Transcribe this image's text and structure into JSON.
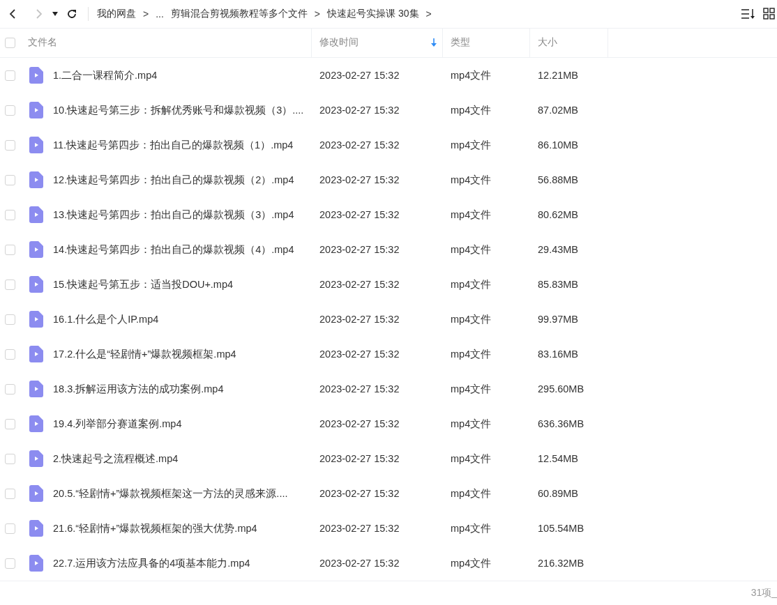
{
  "toolbar": {
    "back_disabled": false,
    "forward_disabled": true,
    "breadcrumb": [
      {
        "label": "我的网盘",
        "kind": "crumb"
      },
      {
        "label": ">",
        "kind": "sep"
      },
      {
        "label": "...",
        "kind": "crumb"
      },
      {
        "label": "剪辑混合剪视频教程等多个文件",
        "kind": "crumb"
      },
      {
        "label": ">",
        "kind": "sep"
      },
      {
        "label": "快速起号实操课 30集",
        "kind": "crumb"
      },
      {
        "label": ">",
        "kind": "sep"
      }
    ]
  },
  "table": {
    "all_checked": false,
    "columns": [
      {
        "label": "文件名",
        "sorted": false
      },
      {
        "label": "修改时间",
        "sorted": true
      },
      {
        "label": "类型",
        "sorted": false
      },
      {
        "label": "大小",
        "sorted": false
      }
    ],
    "rows": [
      {
        "name": "1.二合一课程简介.mp4",
        "modified": "2023-02-27 15:32",
        "type": "mp4文件",
        "size": "12.21MB",
        "checked": false
      },
      {
        "name": "10.快速起号第三步：拆解优秀账号和爆款视频（3）....",
        "modified": "2023-02-27 15:32",
        "type": "mp4文件",
        "size": "87.02MB",
        "checked": false
      },
      {
        "name": "11.快速起号第四步：拍出自己的爆款视频（1）.mp4",
        "modified": "2023-02-27 15:32",
        "type": "mp4文件",
        "size": "86.10MB",
        "checked": false
      },
      {
        "name": "12.快速起号第四步：拍出自己的爆款视频（2）.mp4",
        "modified": "2023-02-27 15:32",
        "type": "mp4文件",
        "size": "56.88MB",
        "checked": false
      },
      {
        "name": "13.快速起号第四步：拍出自己的爆款视频（3）.mp4",
        "modified": "2023-02-27 15:32",
        "type": "mp4文件",
        "size": "80.62MB",
        "checked": false
      },
      {
        "name": "14.快速起号第四步：拍出自己的爆款视频（4）.mp4",
        "modified": "2023-02-27 15:32",
        "type": "mp4文件",
        "size": "29.43MB",
        "checked": false
      },
      {
        "name": "15.快速起号第五步：适当投DOU+.mp4",
        "modified": "2023-02-27 15:32",
        "type": "mp4文件",
        "size": "85.83MB",
        "checked": false
      },
      {
        "name": "16.1.什么是个人IP.mp4",
        "modified": "2023-02-27 15:32",
        "type": "mp4文件",
        "size": "99.97MB",
        "checked": false
      },
      {
        "name": "17.2.什么是“轻剧情+”爆款视频框架.mp4",
        "modified": "2023-02-27 15:32",
        "type": "mp4文件",
        "size": "83.16MB",
        "checked": false
      },
      {
        "name": "18.3.拆解运用该方法的成功案例.mp4",
        "modified": "2023-02-27 15:32",
        "type": "mp4文件",
        "size": "295.60MB",
        "checked": false
      },
      {
        "name": "19.4.列举部分赛道案例.mp4",
        "modified": "2023-02-27 15:32",
        "type": "mp4文件",
        "size": "636.36MB",
        "checked": false
      },
      {
        "name": "2.快速起号之流程概述.mp4",
        "modified": "2023-02-27 15:32",
        "type": "mp4文件",
        "size": "12.54MB",
        "checked": false
      },
      {
        "name": "20.5.“轻剧情+”爆款视频框架这一方法的灵感来源....",
        "modified": "2023-02-27 15:32",
        "type": "mp4文件",
        "size": "60.89MB",
        "checked": false
      },
      {
        "name": "21.6.“轻剧情+”爆款视频框架的强大优势.mp4",
        "modified": "2023-02-27 15:32",
        "type": "mp4文件",
        "size": "105.54MB",
        "checked": false
      },
      {
        "name": "22.7.运用该方法应具备的4项基本能力.mp4",
        "modified": "2023-02-27 15:32",
        "type": "mp4文件",
        "size": "216.32MB",
        "checked": false
      }
    ]
  },
  "status_bar": {
    "count": "31项_"
  }
}
